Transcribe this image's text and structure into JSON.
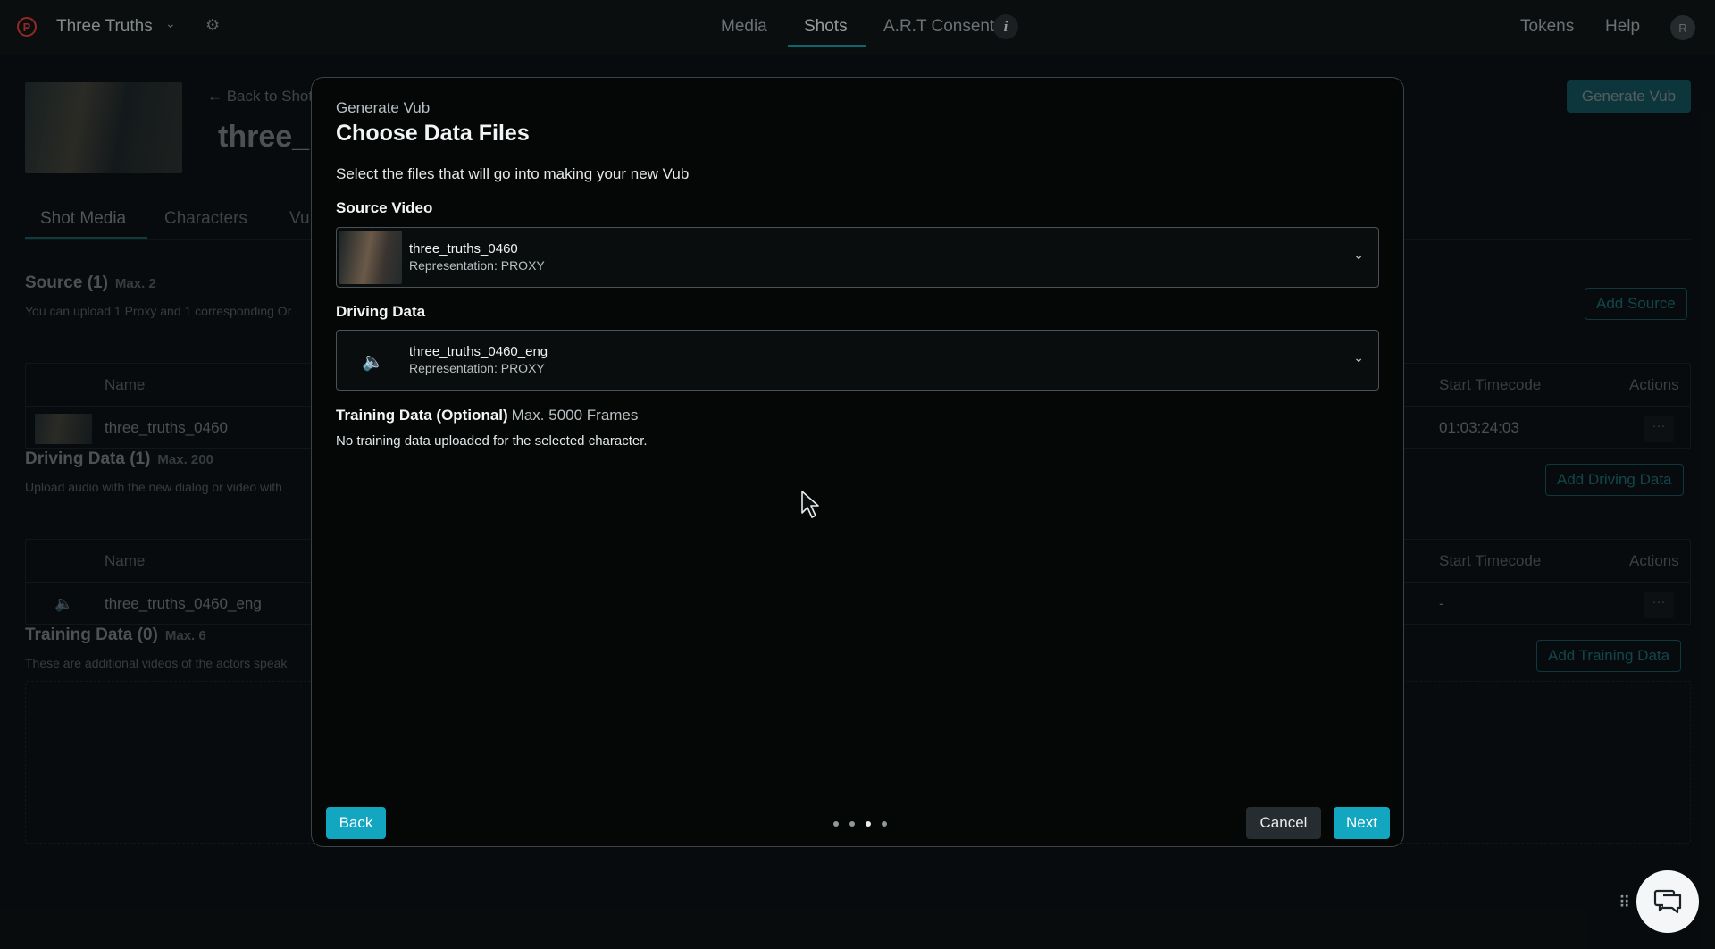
{
  "topbar": {
    "logo_letter": "P",
    "project_name": "Three Truths",
    "tabs": [
      "Media",
      "Shots",
      "A.R.T Consent"
    ],
    "active_tab": "Shots",
    "right_links": [
      "Tokens",
      "Help"
    ],
    "avatar_initial": "R"
  },
  "page": {
    "back_label": "← Back to Shot",
    "shot_title": "three_",
    "generate_button": "Generate Vub",
    "subtabs": [
      "Shot Media",
      "Characters",
      "Vu"
    ],
    "source": {
      "title": "Source (1)",
      "max": "Max. 2",
      "desc": "You can upload 1 Proxy and 1 corresponding Or",
      "add_button": "Add Source",
      "headers": {
        "name": "Name",
        "timecode": "Start Timecode",
        "actions": "Actions"
      },
      "row": {
        "name": "three_truths_0460",
        "timecode": "01:03:24:03",
        "more": "···"
      }
    },
    "driving": {
      "title": "Driving Data (1)",
      "max": "Max. 200",
      "desc": "Upload audio with the new dialog or video with",
      "add_button": "Add Driving Data",
      "headers": {
        "name": "Name",
        "timecode": "Start Timecode",
        "actions": "Actions"
      },
      "row": {
        "name": "three_truths_0460_eng",
        "timecode": "-",
        "more": "···"
      }
    },
    "training": {
      "title": "Training Data (0)",
      "max": "Max. 6",
      "desc": "These are additional videos of the actors speak",
      "add_button": "Add Training Data"
    }
  },
  "modal": {
    "eyebrow": "Generate Vub",
    "title": "Choose Data Files",
    "description": "Select the files that will go into making your new Vub",
    "source_label": "Source Video",
    "source_select": {
      "name": "three_truths_0460",
      "representation": "Representation: PROXY"
    },
    "driving_label": "Driving Data",
    "driving_select": {
      "name": "three_truths_0460_eng",
      "representation": "Representation: PROXY"
    },
    "training_label": "Training Data (Optional)",
    "training_max": "Max. 5000 Frames",
    "training_empty": "No training data uploaded for the selected character.",
    "back_button": "Back",
    "cancel_button": "Cancel",
    "next_button": "Next",
    "step_count": 4,
    "current_step": 3
  },
  "icons": [
    "settings-icon",
    "chevron-down-icon",
    "info-icon",
    "speaker-icon",
    "chat-icon",
    "drag-grip-icon",
    "cursor-icon"
  ],
  "colors": {
    "accent": "#13a6c0",
    "brand": "#e0403a",
    "background": "#0d1214",
    "modal": "#050707"
  }
}
